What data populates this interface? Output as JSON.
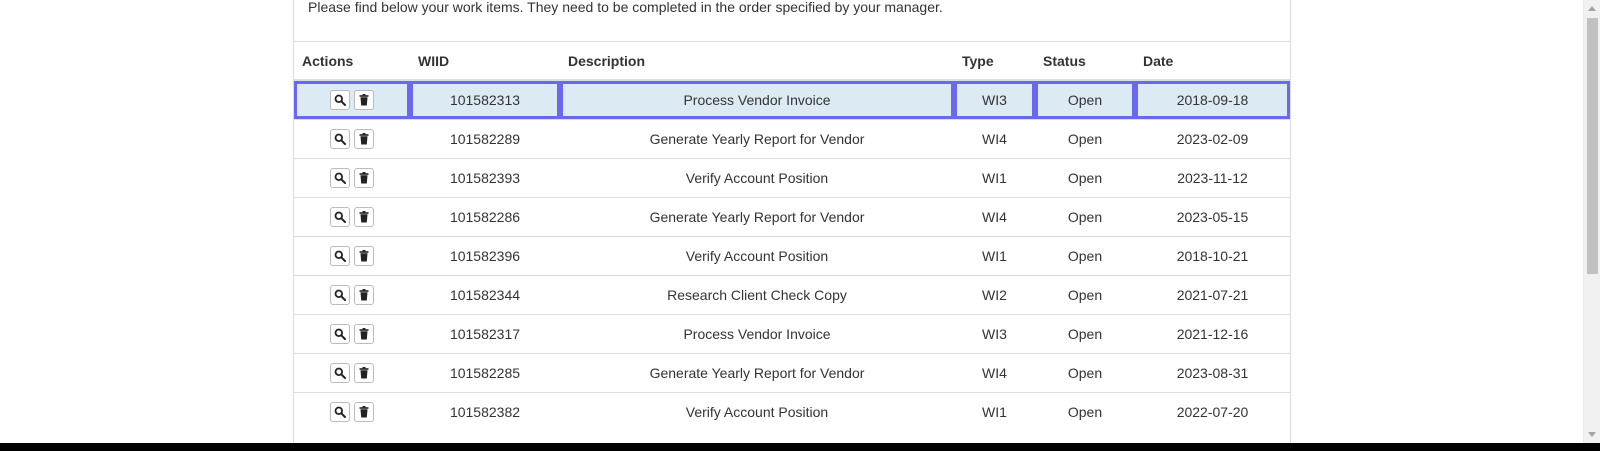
{
  "intro_text": "Please find below your work items. They need to be completed in the order specified by your manager.",
  "table": {
    "columns": [
      "Actions",
      "WIID",
      "Description",
      "Type",
      "Status",
      "Date"
    ],
    "rows": [
      {
        "wiid": "101582313",
        "description": "Process Vendor Invoice",
        "type": "WI3",
        "status": "Open",
        "date": "2018-09-18",
        "selected": true
      },
      {
        "wiid": "101582289",
        "description": "Generate Yearly Report for Vendor",
        "type": "WI4",
        "status": "Open",
        "date": "2023-02-09",
        "selected": false
      },
      {
        "wiid": "101582393",
        "description": "Verify Account Position",
        "type": "WI1",
        "status": "Open",
        "date": "2023-11-12",
        "selected": false
      },
      {
        "wiid": "101582286",
        "description": "Generate Yearly Report for Vendor",
        "type": "WI4",
        "status": "Open",
        "date": "2023-05-15",
        "selected": false
      },
      {
        "wiid": "101582396",
        "description": "Verify Account Position",
        "type": "WI1",
        "status": "Open",
        "date": "2018-10-21",
        "selected": false
      },
      {
        "wiid": "101582344",
        "description": "Research Client Check Copy",
        "type": "WI2",
        "status": "Open",
        "date": "2021-07-21",
        "selected": false
      },
      {
        "wiid": "101582317",
        "description": "Process Vendor Invoice",
        "type": "WI3",
        "status": "Open",
        "date": "2021-12-16",
        "selected": false
      },
      {
        "wiid": "101582285",
        "description": "Generate Yearly Report for Vendor",
        "type": "WI4",
        "status": "Open",
        "date": "2023-08-31",
        "selected": false
      },
      {
        "wiid": "101582382",
        "description": "Verify Account Position",
        "type": "WI1",
        "status": "Open",
        "date": "2022-07-20",
        "selected": false
      }
    ]
  },
  "icons": {
    "view": "search-icon",
    "delete": "trash-icon"
  },
  "colors": {
    "selected_row_bg": "#dcebf3",
    "selected_row_border": "#6969f0"
  }
}
